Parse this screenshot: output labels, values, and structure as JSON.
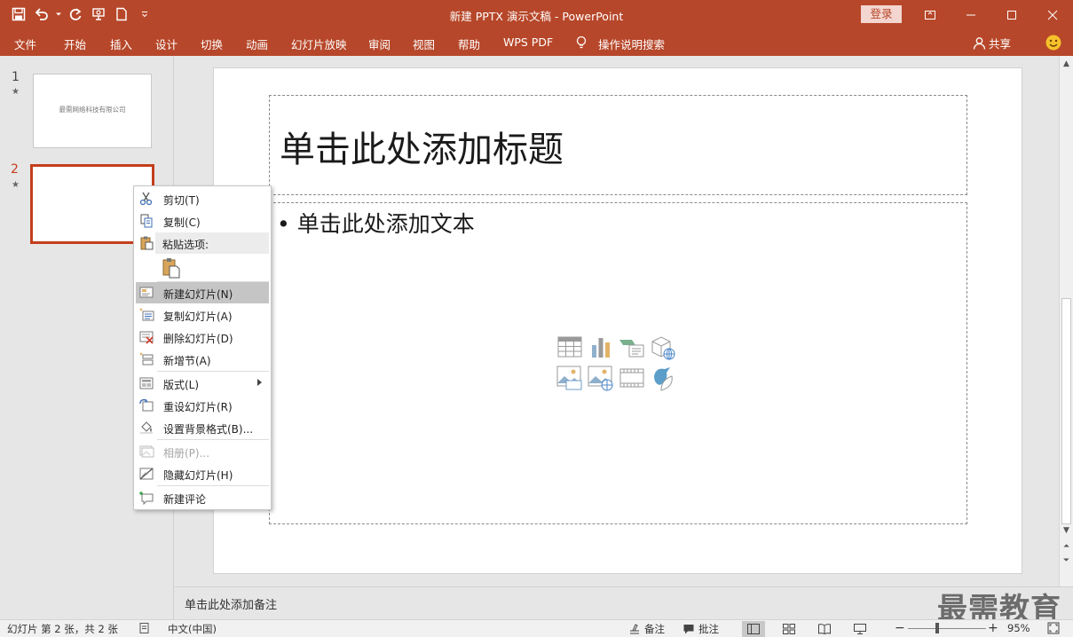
{
  "app": {
    "title": "新建 PPTX 演示文稿  -  PowerPoint",
    "login_label": "登录",
    "brand_color": "#b7472a",
    "accent_color": "#c43e1c"
  },
  "qat": {
    "icons": [
      "save-icon",
      "undo-icon",
      "redo-icon",
      "present-icon",
      "new-doc-icon",
      "customize-icon"
    ]
  },
  "ribbon": {
    "tabs": [
      "文件",
      "开始",
      "插入",
      "设计",
      "切换",
      "动画",
      "幻灯片放映",
      "审阅",
      "视图",
      "帮助",
      "WPS PDF"
    ],
    "tell_me": "操作说明搜索",
    "share": "共享"
  },
  "thumbnails": [
    {
      "num": "1",
      "star": "★",
      "text": "最需网络科技有限公司"
    },
    {
      "num": "2",
      "star": "★",
      "text": ""
    }
  ],
  "slide": {
    "title_placeholder": "单击此处添加标题",
    "body_placeholder": "• 单击此处添加文本",
    "insert_icons": [
      "table-icon",
      "chart-icon",
      "smartart-icon",
      "3d-model-icon",
      "picture-icon",
      "online-picture-icon",
      "video-icon",
      "icons-icon"
    ]
  },
  "notes": {
    "placeholder": "单击此处添加备注"
  },
  "watermark": "最需教育",
  "context_menu": {
    "items": [
      {
        "label": "剪切(T)"
      },
      {
        "label": "复制(C)"
      },
      {
        "label": "粘贴选项:"
      },
      {
        "label": "新建幻灯片(N)"
      },
      {
        "label": "复制幻灯片(A)"
      },
      {
        "label": "删除幻灯片(D)"
      },
      {
        "label": "新增节(A)"
      },
      {
        "label": "版式(L)"
      },
      {
        "label": "重设幻灯片(R)"
      },
      {
        "label": "设置背景格式(B)..."
      },
      {
        "label": "相册(P)..."
      },
      {
        "label": "隐藏幻灯片(H)"
      },
      {
        "label": "新建评论"
      }
    ]
  },
  "status": {
    "slide_info": "幻灯片 第 2 张，共 2 张",
    "language": "中文(中国)",
    "notes_btn": "备注",
    "comments_btn": "批注",
    "zoom_minus": "−",
    "zoom_plus": "+",
    "zoom_percent": "95%",
    "zoom_level": 0.95
  }
}
